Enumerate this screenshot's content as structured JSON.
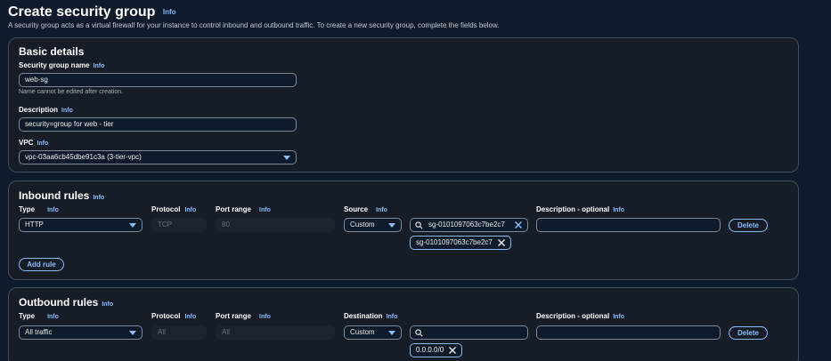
{
  "header": {
    "title": "Create security group",
    "info": "Info",
    "description": "A security group acts as a virtual firewall for your instance to control inbound and outbound traffic. To create a new security group, complete the fields below."
  },
  "basic": {
    "title": "Basic details",
    "name_label": "Security group name",
    "name_value": "web-sg",
    "name_hint": "Name cannot be edited after creation.",
    "desc_label": "Description",
    "desc_value": "security=group for web - tier",
    "vpc_label": "VPC",
    "vpc_value": "vpc-03aa6cb45dbe91c3a (3-tier-vpc)"
  },
  "inbound": {
    "title": "Inbound rules",
    "cols": {
      "type": "Type",
      "protocol": "Protocol",
      "port": "Port range",
      "source": "Source",
      "desc": "Description - optional"
    },
    "rule": {
      "type": "HTTP",
      "protocol": "TCP",
      "port": "80",
      "source": "Custom",
      "search": "sg-0101097063c7be2c7",
      "token": "sg-0101097063c7be2c7",
      "delete": "Delete"
    },
    "add_rule": "Add rule"
  },
  "outbound": {
    "title": "Outbound rules",
    "cols": {
      "type": "Type",
      "protocol": "Protocol",
      "port": "Port range",
      "dest": "Destination",
      "desc": "Description - optional"
    },
    "rule": {
      "type": "All traffic",
      "protocol": "All",
      "port": "All",
      "dest": "Custom",
      "search": "",
      "token": "0.0.0.0/0",
      "delete": "Delete"
    }
  },
  "theme": {
    "accent": "#89bdff",
    "background": "#0f1b2a",
    "panel": "#161d26"
  }
}
